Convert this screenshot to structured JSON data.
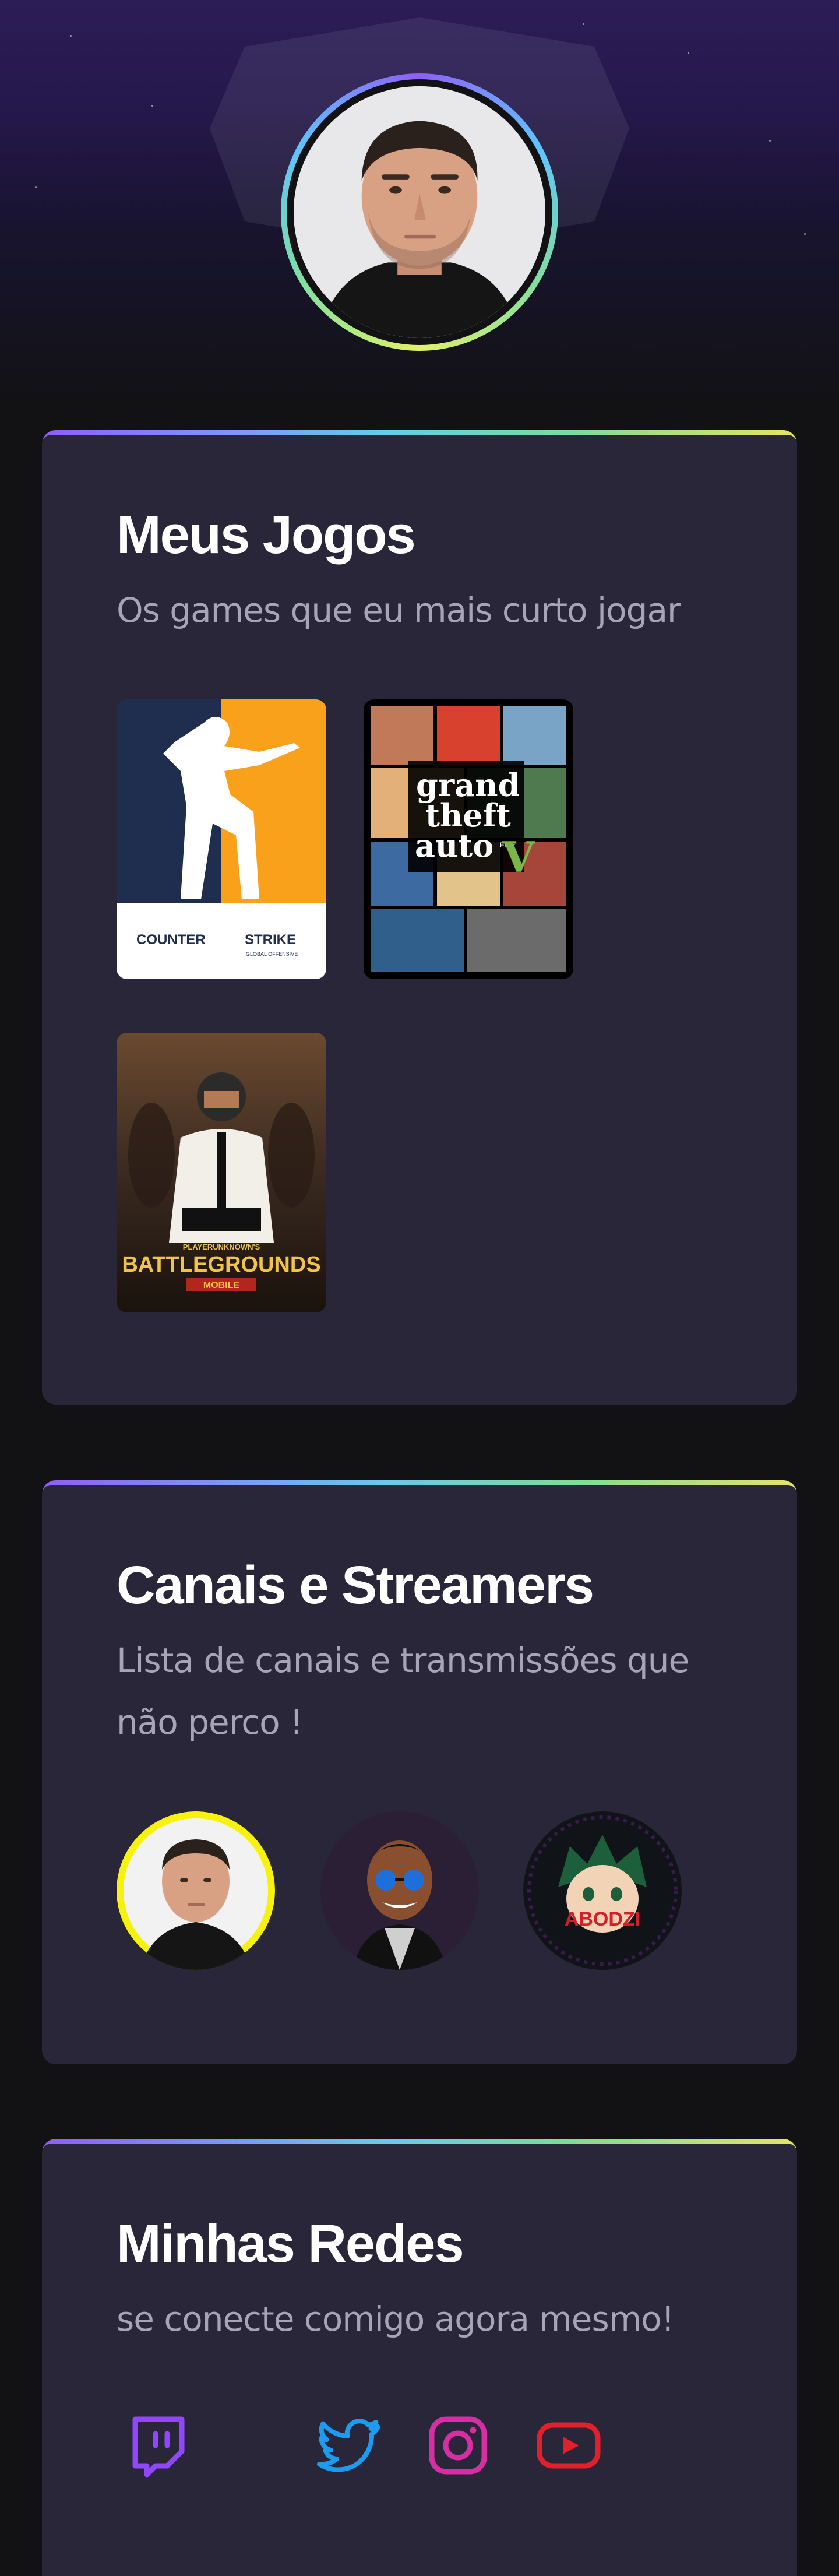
{
  "profile": {
    "avatar_alt": "Foto de perfil"
  },
  "games_section": {
    "title": "Meus Jogos",
    "subtitle": "Os games que eu mais curto jogar",
    "games": [
      {
        "name": "Counter-Strike: Global Offensive",
        "cover_text": [
          "COUNTER",
          "STRIKE"
        ],
        "cover_subtext": "GLOBAL OFFENSIVE",
        "colors": {
          "left": "#1f2d4e",
          "right": "#f9a11b",
          "base": "#ffffff"
        }
      },
      {
        "name": "Grand Theft Auto V",
        "cover_text": [
          "grand",
          "theft",
          "auto"
        ],
        "cover_subtext": "FIVE"
      },
      {
        "name": "PUBG Mobile",
        "cover_text": [
          "PLAYERUNKNOWN'S",
          "BATTLEGROUNDS",
          "MOBILE"
        ]
      }
    ]
  },
  "streamers_section": {
    "title": "Canais e Streamers",
    "subtitle": "Lista de canais e transmissões que não perco !",
    "streamers": [
      {
        "alt": "streamer-1",
        "bg": "#f6f20d"
      },
      {
        "alt": "streamer-2",
        "bg": "#2b1f36"
      },
      {
        "alt": "streamer-3",
        "badge_text": "ABODZI",
        "bg": "#101418"
      }
    ]
  },
  "social_section": {
    "title": "Minhas Redes",
    "subtitle": "se conecte comigo agora mesmo!",
    "links": [
      {
        "name": "Twitch",
        "icon": "twitch-icon",
        "color": "#9146ff"
      },
      {
        "name": "Twitter",
        "icon": "twitter-icon",
        "color": "#1d9bf0"
      },
      {
        "name": "Instagram",
        "icon": "instagram-icon",
        "color": "#e1306c"
      },
      {
        "name": "YouTube",
        "icon": "youtube-icon",
        "color": "#ff0000"
      }
    ]
  }
}
